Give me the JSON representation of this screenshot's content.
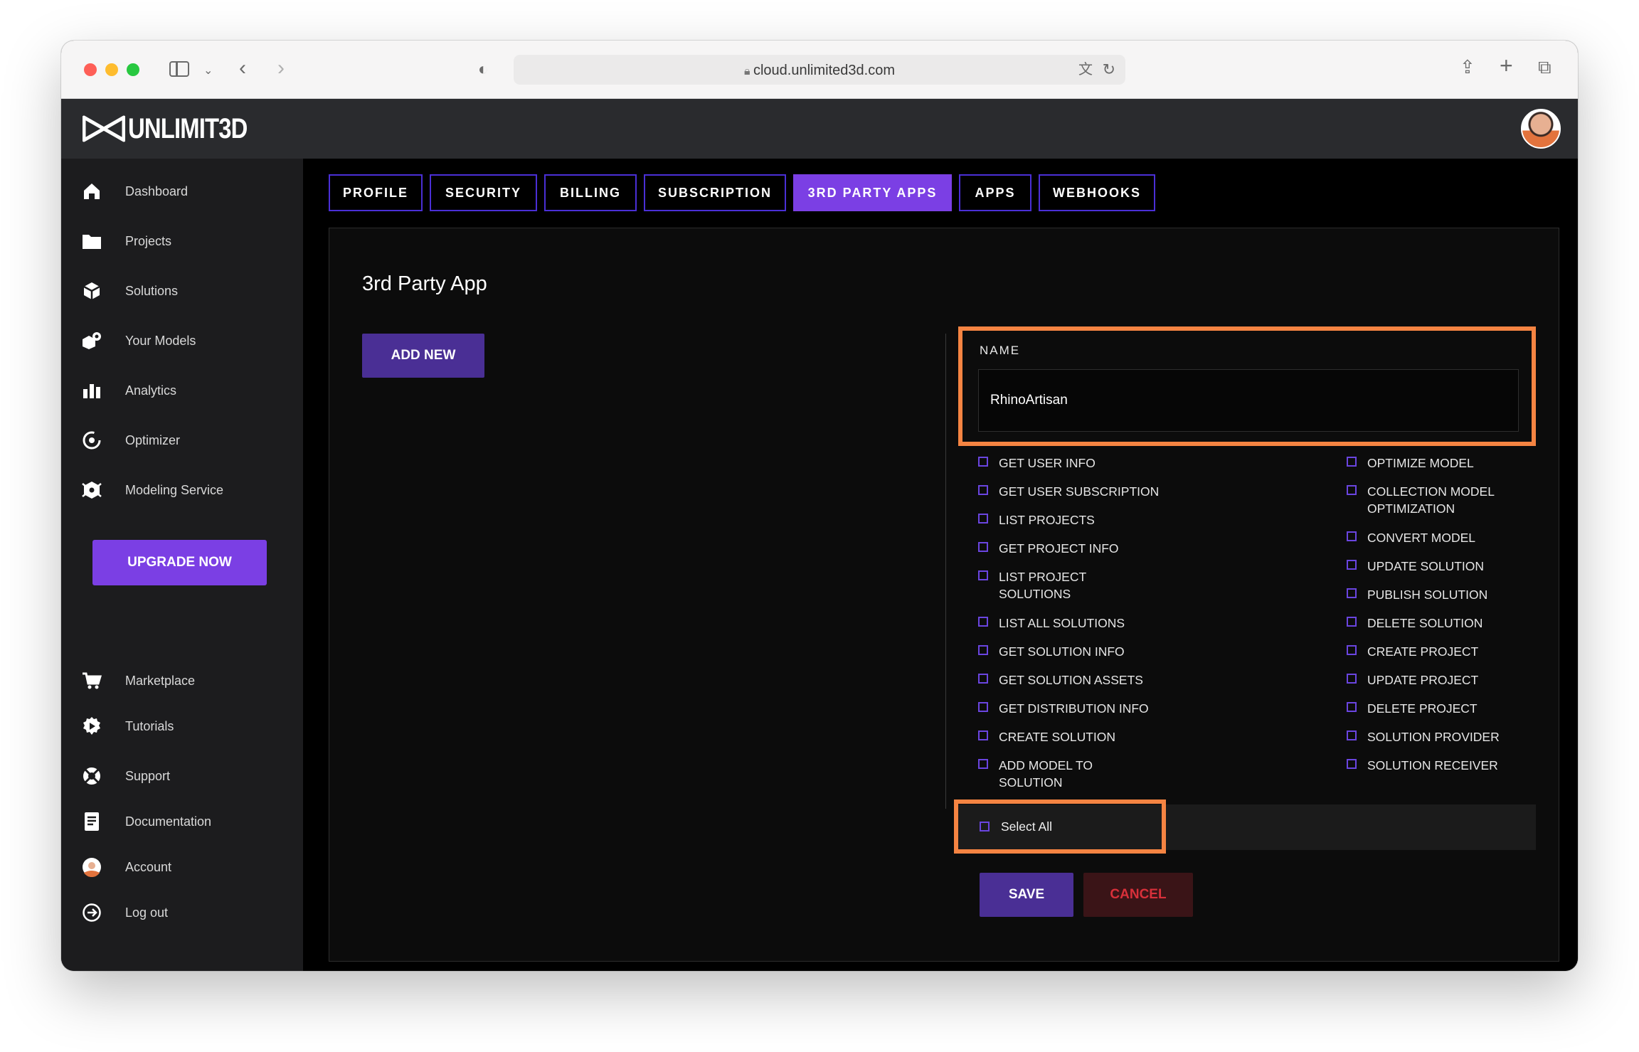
{
  "browser": {
    "url": "cloud.unlimited3d.com"
  },
  "app": {
    "logo_text": "UNLIMIT3D"
  },
  "sidebar": {
    "items": [
      {
        "label": "Dashboard",
        "icon": "home-icon"
      },
      {
        "label": "Projects",
        "icon": "folder-icon"
      },
      {
        "label": "Solutions",
        "icon": "cube-icon"
      },
      {
        "label": "Your Models",
        "icon": "models-icon"
      },
      {
        "label": "Analytics",
        "icon": "bar-chart-icon"
      },
      {
        "label": "Optimizer",
        "icon": "optimizer-icon"
      },
      {
        "label": "Modeling Service",
        "icon": "modeling-icon"
      }
    ],
    "upgrade_label": "UPGRADE NOW",
    "bottom_items": [
      {
        "label": "Marketplace",
        "icon": "cart-icon"
      },
      {
        "label": "Tutorials",
        "icon": "tutorials-icon"
      },
      {
        "label": "Support",
        "icon": "support-icon"
      },
      {
        "label": "Documentation",
        "icon": "document-icon"
      },
      {
        "label": "Account",
        "icon": "account-avatar-icon"
      },
      {
        "label": "Log out",
        "icon": "logout-icon"
      }
    ]
  },
  "tabs": [
    {
      "label": "PROFILE",
      "active": false
    },
    {
      "label": "SECURITY",
      "active": false
    },
    {
      "label": "BILLING",
      "active": false
    },
    {
      "label": "SUBSCRIPTION",
      "active": false
    },
    {
      "label": "3RD PARTY APPS",
      "active": true
    },
    {
      "label": "APPS",
      "active": false
    },
    {
      "label": "WEBHOOKS",
      "active": false
    }
  ],
  "panel": {
    "title": "3rd Party App",
    "add_new_label": "ADD NEW",
    "name_label": "NAME",
    "name_value": "RhinoArtisan",
    "permissions_left": [
      "GET USER INFO",
      "GET USER SUBSCRIPTION",
      "LIST PROJECTS",
      "GET PROJECT INFO",
      "LIST PROJECT SOLUTIONS",
      "LIST ALL SOLUTIONS",
      "GET SOLUTION INFO",
      "GET SOLUTION ASSETS",
      "GET DISTRIBUTION INFO",
      "CREATE SOLUTION",
      "ADD MODEL TO SOLUTION"
    ],
    "permissions_right": [
      "OPTIMIZE MODEL",
      "COLLECTION MODEL OPTIMIZATION",
      "CONVERT MODEL",
      "UPDATE SOLUTION",
      "PUBLISH SOLUTION",
      "DELETE SOLUTION",
      "CREATE PROJECT",
      "UPDATE PROJECT",
      "DELETE PROJECT",
      "SOLUTION PROVIDER",
      "SOLUTION RECEIVER"
    ],
    "select_all_label": "Select All",
    "save_label": "SAVE",
    "cancel_label": "CANCEL"
  },
  "colors": {
    "accent_purple": "#7b3fe4",
    "button_purple": "#4a2f95",
    "highlight_orange": "#f58442",
    "cancel_red": "#d8303a"
  }
}
